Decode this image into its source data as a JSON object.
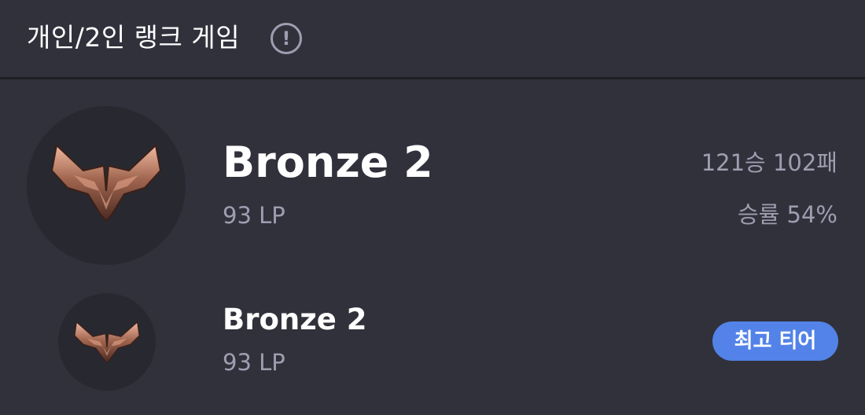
{
  "header": {
    "title": "개인/2인 랭크 게임",
    "info_icon": "info-circle-icon",
    "info_glyph": "!"
  },
  "current": {
    "emblem_icon": "bronze-emblem-icon",
    "tier": "Bronze 2",
    "lp": "93 LP",
    "record": "121승 102패",
    "win_rate": "승률 54%"
  },
  "best": {
    "emblem_icon": "bronze-emblem-icon",
    "tier": "Bronze 2",
    "lp": "93 LP",
    "badge": "최고 티어"
  },
  "colors": {
    "background": "#31313c",
    "emblem_circle": "#282830",
    "muted_text": "#9e9eb1",
    "badge": "#5383e8",
    "bronze": "#a0654f"
  }
}
